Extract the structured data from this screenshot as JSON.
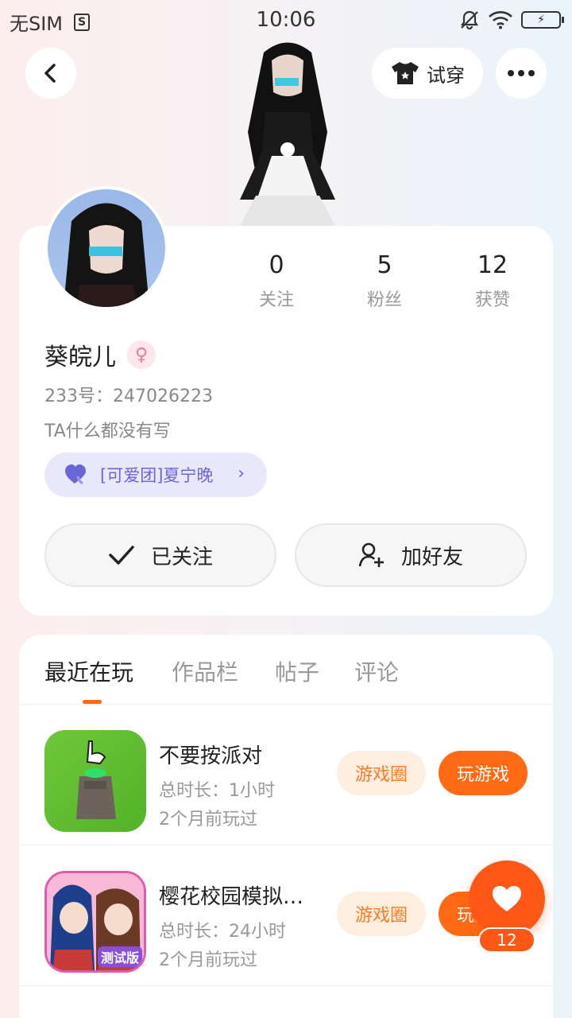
{
  "status_bar": {
    "carrier": "无SIM",
    "time": "10:06"
  },
  "header": {
    "tryon_label": "试穿"
  },
  "profile": {
    "name": "葵皖儿",
    "uid": "233号：247026223",
    "bio": "TA什么都没有写",
    "team": "[可爱团]夏宁晚",
    "stats": [
      {
        "value": "0",
        "label": "关注"
      },
      {
        "value": "5",
        "label": "粉丝"
      },
      {
        "value": "12",
        "label": "获赞"
      }
    ],
    "followed_label": "已关注",
    "add_friend_label": "加好友"
  },
  "tabs": [
    "最近在玩",
    "作品栏",
    "帖子",
    "评论"
  ],
  "games": [
    {
      "title": "不要按派对",
      "duration": "总时长：1小时",
      "last_played": "2个月前玩过",
      "circle_label": "游戏圈",
      "play_label": "玩游戏"
    },
    {
      "title": "樱花校园模拟…",
      "duration": "总时长：24小时",
      "last_played": "2个月前玩过",
      "circle_label": "游戏圈",
      "play_label": "玩游戏",
      "badge": "测试版"
    }
  ],
  "fab": {
    "count": "12"
  },
  "colors": {
    "accent": "#ff6a13",
    "team_tag": "#6a66d8"
  }
}
